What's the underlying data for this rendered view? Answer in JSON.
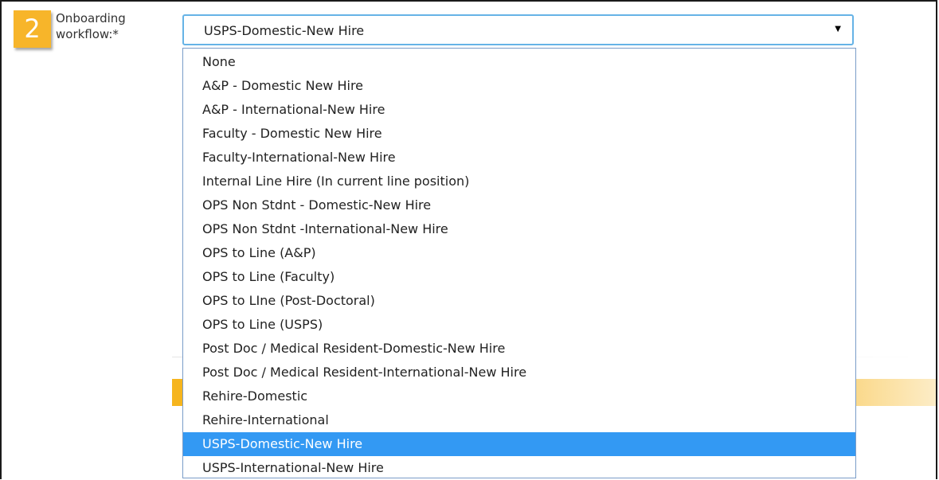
{
  "step_number": "2",
  "onboarding": {
    "label_line1": "Onboarding",
    "label_line2": "workflow:*",
    "selected_value": "USPS-Domestic-New Hire",
    "arrow_icon": "triangle-down",
    "options": [
      {
        "label": "None",
        "selected": false
      },
      {
        "label": "A&P - Domestic New Hire",
        "selected": false
      },
      {
        "label": "A&P - International-New Hire",
        "selected": false
      },
      {
        "label": "Faculty - Domestic New Hire",
        "selected": false
      },
      {
        "label": "Faculty-International-New Hire",
        "selected": false
      },
      {
        "label": "Internal Line Hire (In current line position)",
        "selected": false
      },
      {
        "label": "OPS Non Stdnt - Domestic-New Hire",
        "selected": false
      },
      {
        "label": "OPS Non Stdnt -International-New Hire",
        "selected": false
      },
      {
        "label": "OPS to Line (A&P)",
        "selected": false
      },
      {
        "label": "OPS to Line (Faculty)",
        "selected": false
      },
      {
        "label": "OPS to LIne (Post-Doctoral)",
        "selected": false
      },
      {
        "label": "OPS to Line (USPS)",
        "selected": false
      },
      {
        "label": "Post Doc / Medical Resident-Domestic-New Hire",
        "selected": false
      },
      {
        "label": "Post Doc / Medical Resident-International-New Hire",
        "selected": false
      },
      {
        "label": "Rehire-Domestic",
        "selected": false
      },
      {
        "label": "Rehire-International",
        "selected": false
      },
      {
        "label": "USPS-Domestic-New Hire",
        "selected": true
      },
      {
        "label": "USPS-International-New Hire",
        "selected": false
      }
    ]
  },
  "colors": {
    "step_badge": "#f7b52a",
    "select_border": "#66b3e6",
    "selected_option_bg": "#3399f3",
    "accent_bar": "#f6b51e"
  }
}
